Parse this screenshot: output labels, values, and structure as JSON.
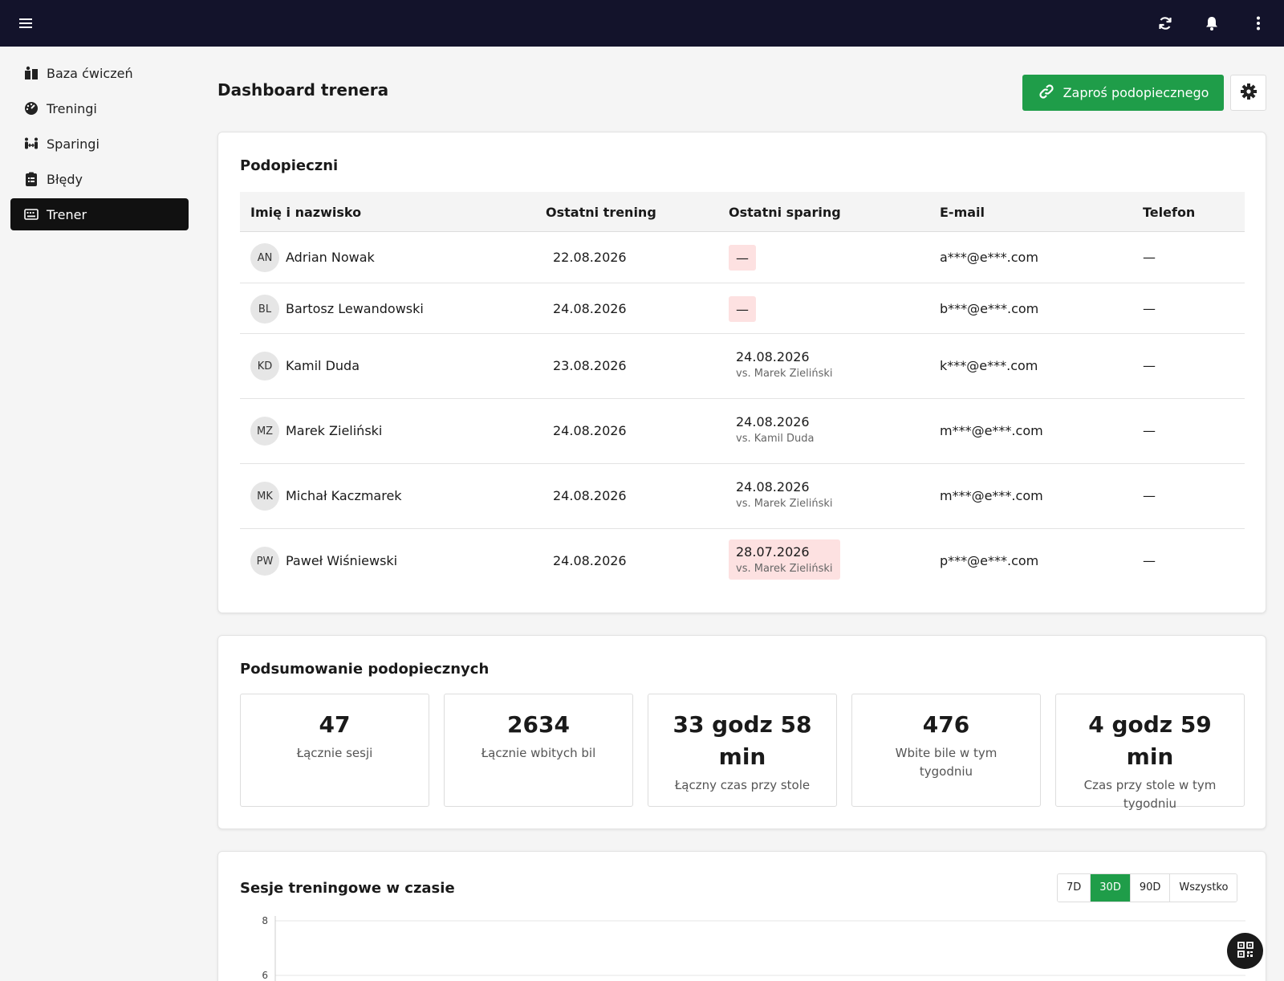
{
  "topbar": {
    "menu_icon": "hamburger-icon",
    "icons": [
      "refresh-icon",
      "bell-icon",
      "more-vertical-icon"
    ]
  },
  "sidebar": {
    "items": [
      {
        "label": "Baza ćwiczeń",
        "icon": "book-icon",
        "active": false
      },
      {
        "label": "Treningi",
        "icon": "gauge-icon",
        "active": false
      },
      {
        "label": "Sparingi",
        "icon": "people-arrows-icon",
        "active": false
      },
      {
        "label": "Błędy",
        "icon": "clipboard-list-icon",
        "active": false
      },
      {
        "label": "Trener",
        "icon": "keyboard-icon",
        "active": true
      }
    ]
  },
  "header": {
    "title": "Dashboard trenera",
    "invite_label": "Zaproś podopiecznego",
    "accent": "#1f9d49"
  },
  "trainees": {
    "title": "Podopieczni",
    "columns": [
      "Imię i nazwisko",
      "Ostatni trening",
      "Ostatni sparing",
      "E-mail",
      "Telefon"
    ],
    "rows": [
      {
        "initials": "AN",
        "name": "Adrian Nowak",
        "last_training": "22.08.2026",
        "sparing_date": "—",
        "sparing_vs": "",
        "sparing_warn": true,
        "email": "a***@e***.com",
        "phone": "—"
      },
      {
        "initials": "BL",
        "name": "Bartosz Lewandowski",
        "last_training": "24.08.2026",
        "sparing_date": "—",
        "sparing_vs": "",
        "sparing_warn": true,
        "email": "b***@e***.com",
        "phone": "—"
      },
      {
        "initials": "KD",
        "name": "Kamil Duda",
        "last_training": "23.08.2026",
        "sparing_date": "24.08.2026",
        "sparing_vs": "vs. Marek Zieliński",
        "sparing_warn": false,
        "email": "k***@e***.com",
        "phone": "—"
      },
      {
        "initials": "MZ",
        "name": "Marek Zieliński",
        "last_training": "24.08.2026",
        "sparing_date": "24.08.2026",
        "sparing_vs": "vs. Kamil Duda",
        "sparing_warn": false,
        "email": "m***@e***.com",
        "phone": "—"
      },
      {
        "initials": "MK",
        "name": "Michał Kaczmarek",
        "last_training": "24.08.2026",
        "sparing_date": "24.08.2026",
        "sparing_vs": "vs. Marek Zieliński",
        "sparing_warn": false,
        "email": "m***@e***.com",
        "phone": "—"
      },
      {
        "initials": "PW",
        "name": "Paweł Wiśniewski",
        "last_training": "24.08.2026",
        "sparing_date": "28.07.2026",
        "sparing_vs": "vs. Marek Zieliński",
        "sparing_warn": true,
        "email": "p***@e***.com",
        "phone": "—"
      }
    ]
  },
  "summary": {
    "title": "Podsumowanie podopiecznych",
    "stats": [
      {
        "value": "47",
        "label": "Łącznie sesji"
      },
      {
        "value": "2634",
        "label": "Łącznie wbitych bil"
      },
      {
        "value": "33 godz 58 min",
        "label": "Łączny czas przy stole"
      },
      {
        "value": "476",
        "label": "Wbite bile w tym tygodniu"
      },
      {
        "value": "4 godz 59 min",
        "label": "Czas przy stole w tym tygodniu"
      }
    ]
  },
  "sessions_chart": {
    "title": "Sesje treningowe w czasie",
    "ranges": [
      {
        "label": "7D",
        "active": false
      },
      {
        "label": "30D",
        "active": true
      },
      {
        "label": "90D",
        "active": false
      },
      {
        "label": "Wszystko",
        "active": false
      }
    ]
  },
  "chart_data": {
    "type": "line",
    "title": "Sesje treningowe w czasie",
    "xlabel": "",
    "ylabel": "",
    "y_ticks_visible": [
      "8",
      "6"
    ],
    "grid": true
  },
  "fab": {
    "icon": "qr-code-icon"
  }
}
